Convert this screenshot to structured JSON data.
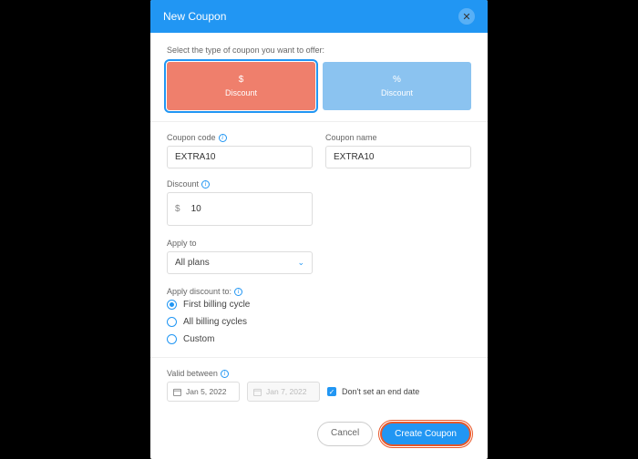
{
  "header": {
    "title": "New Coupon"
  },
  "intro": "Select the type of coupon you want to offer:",
  "types": {
    "dollar": {
      "symbol": "$",
      "label": "Discount"
    },
    "percent": {
      "symbol": "%",
      "label": "Discount"
    }
  },
  "fields": {
    "code_label": "Coupon code",
    "code_value": "EXTRA10",
    "name_label": "Coupon name",
    "name_value": "EXTRA10",
    "discount_label": "Discount",
    "discount_currency": "$",
    "discount_value": "10",
    "apply_to_label": "Apply to",
    "apply_to_value": "All plans",
    "apply_discount_label": "Apply discount to:",
    "radio_first": "First billing cycle",
    "radio_all": "All billing cycles",
    "radio_custom": "Custom",
    "valid_label": "Valid between",
    "date_start": "Jan 5, 2022",
    "date_end": "Jan 7, 2022",
    "no_end_date": "Don't set an end date"
  },
  "footer": {
    "cancel": "Cancel",
    "create": "Create Coupon"
  }
}
